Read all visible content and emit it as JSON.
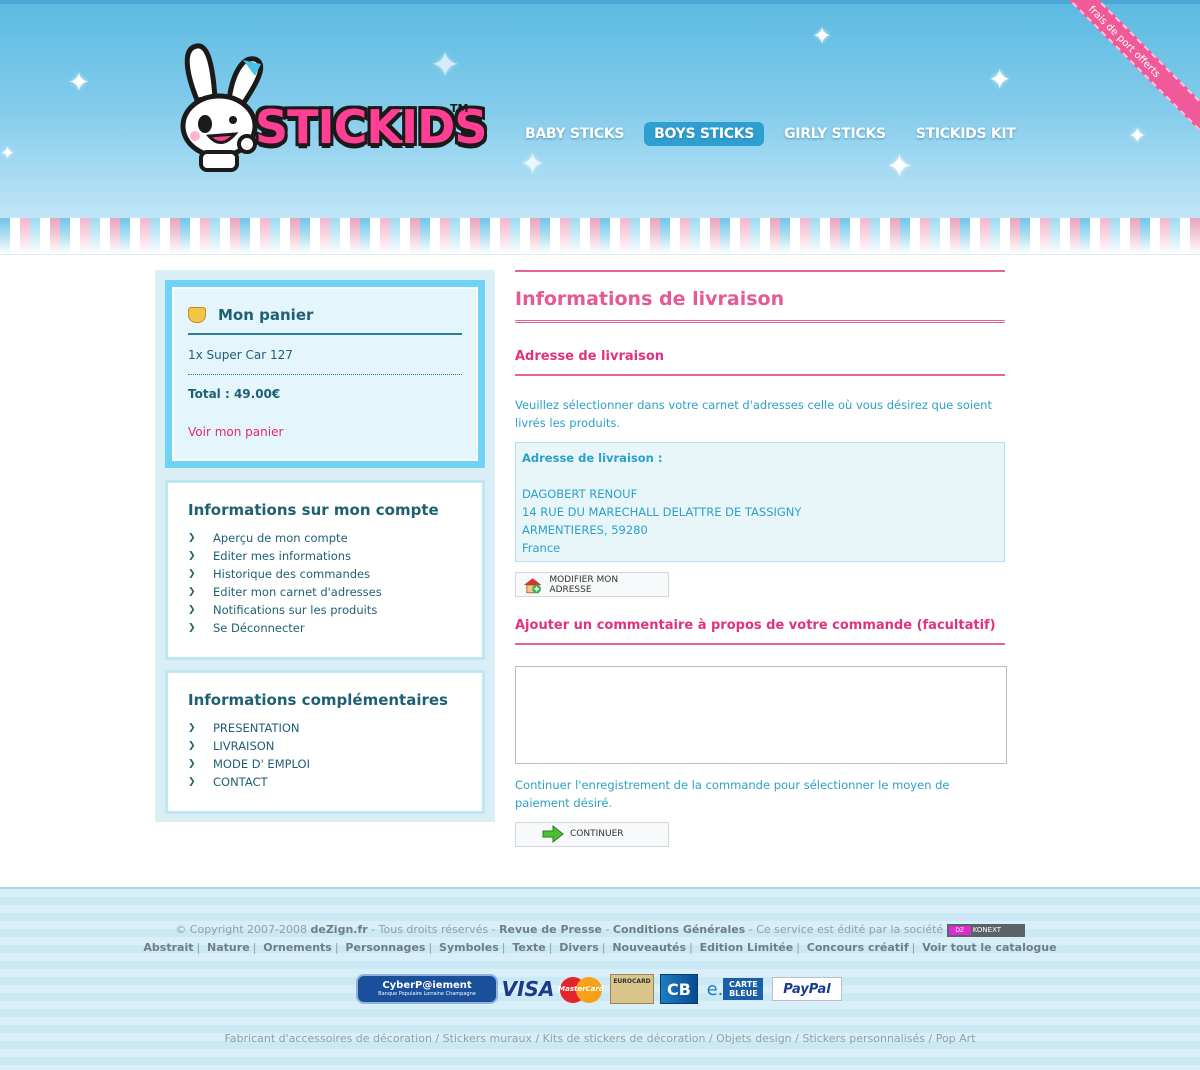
{
  "header": {
    "brand": "STICKIDS",
    "trademark": "TM",
    "ribbon": "frais de port offerts",
    "nav": [
      {
        "label": "BABY STICKS",
        "active": false
      },
      {
        "label": "BOYS STICKS",
        "active": true
      },
      {
        "label": "GIRLY STICKS",
        "active": false
      },
      {
        "label": "STICKIDS KIT",
        "active": false
      }
    ]
  },
  "cart": {
    "title": "Mon panier",
    "item": "1x Super Car 127",
    "total": "Total : 49.00€",
    "link": "Voir mon panier"
  },
  "account": {
    "title": "Informations sur mon compte",
    "links": [
      "Aperçu de mon compte",
      "Editer mes informations",
      "Historique des commandes",
      "Editer mon carnet d'adresses",
      "Notifications sur les produits",
      "Se Déconnecter"
    ]
  },
  "extra": {
    "title": "Informations complémentaires",
    "links": [
      "PRESENTATION",
      "LIVRAISON",
      "MODE D' EMPLOI",
      "CONTACT"
    ]
  },
  "main": {
    "title": "Informations de livraison",
    "address_heading": "Adresse de livraison",
    "address_intro": "Veuillez sélectionner dans votre carnet d'adresses celle où vous désirez que soient livrés les produits.",
    "address_label": "Adresse de livraison :",
    "address_lines": [
      "DAGOBERT RENOUF",
      "14 RUE DU MARECHALL DELATTRE DE TASSIGNY",
      "ARMENTIERES, 59280",
      "France"
    ],
    "modify_button": "MODIFIER MON ADRESSE",
    "comment_heading": "Ajouter un commentaire à propos de votre commande (facultatif)",
    "comment_value": "",
    "continue_text": "Continuer l'enregistrement de la commande pour sélectionner le moyen de paiement désiré.",
    "continue_button": "CONTINUER"
  },
  "footer": {
    "copyright": "© Copyright 2007-2008",
    "dezign": "deZign.fr",
    "rights": " - Tous droits réservés - ",
    "press": "Revue de Presse",
    "dash": " - ",
    "cgv": "Conditions Générales",
    "edited": " - Ce service est édité par la société",
    "konext_dz": "DZ",
    "konext_name": "KONEXT",
    "categories": [
      "Abstrait",
      "Nature",
      "Ornements",
      "Personnages",
      "Symboles",
      "Texte",
      "Divers",
      "Nouveautés",
      "Edition Limitée",
      "Concours créatif",
      "Voir tout le catalogue"
    ],
    "payments": {
      "cyber": "CyberP@iement",
      "cyber_sub": "Banque Populaire Lorraine Champagne",
      "visa": "VISA",
      "mastercard": "MasterCard",
      "eurocard": "EUROCARD",
      "cb": "CB",
      "ecarte": "e.",
      "carte_bleue": "CARTE BLEUE",
      "paypal": "PayPal"
    },
    "seo_links": "Fabricant d'accessoires de décoration / Stickers muraux / Kits de stickers de décoration / Objets design / Stickers personnalisés / Pop Art"
  }
}
